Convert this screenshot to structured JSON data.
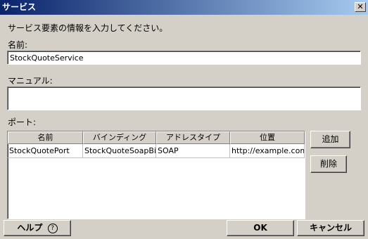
{
  "window": {
    "title": "サービス",
    "close_glyph": "✕"
  },
  "instruction": "サービス要素の情報を入力してください。",
  "name_field": {
    "label": "名前:",
    "value": "StockQuoteService"
  },
  "manual_field": {
    "label": "マニュアル:",
    "value": ""
  },
  "ports": {
    "label": "ポート:",
    "columns": [
      "名前",
      "バインディング",
      "アドレスタイプ",
      "位置"
    ],
    "rows": [
      [
        "StockQuotePort",
        "StockQuoteSoapBi...",
        "SOAP",
        "http://example.com"
      ]
    ]
  },
  "side_buttons": {
    "add": "追加",
    "delete": "削除"
  },
  "footer": {
    "help": "ヘルプ",
    "help_icon": "?",
    "ok": "OK",
    "cancel": "キャンセル"
  }
}
